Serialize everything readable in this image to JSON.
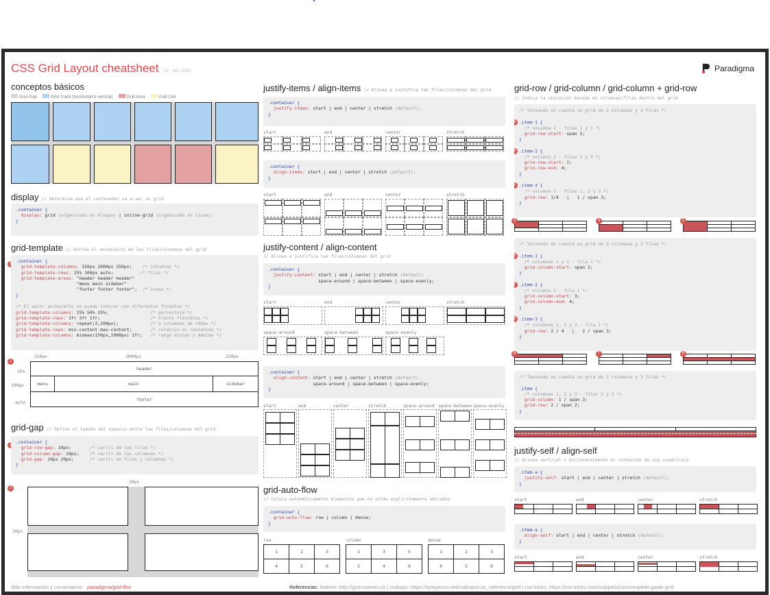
{
  "header": {
    "title": "CSS Grid Layout cheatsheet",
    "version": "V2 - feb. 2020",
    "brand": "Paradigma"
  },
  "colors": {
    "accent": "#e0484e",
    "track": "#aed3f2",
    "area": "#e3a1a2",
    "cell": "#faf3c4",
    "gap": "#d8d8d8"
  },
  "basics": {
    "title": "conceptos básicos",
    "legend": [
      "Grid Gap",
      "Grid Track (horizontal o vertical)",
      "Grid Area",
      "Grid Cell"
    ]
  },
  "display": {
    "title": "display",
    "comment": "// Determina que el contenedor va a ser un grid",
    "code": [
      ".container {",
      "  display:",
      " grid",
      " (organizado en bloque)",
      " | inline-grid",
      " (organizado en línea);",
      "}"
    ]
  },
  "template": {
    "title": "grid-template",
    "comment": "// Define el ancho/alto de las filas/columnas del grid",
    "lines": [
      {
        "t": "s",
        "v": ".container {"
      },
      {
        "t": "p",
        "v": "  grid-template-columns:",
        "r": " 150px 1000px 250px;",
        "c": "    /* columnas */"
      },
      {
        "t": "p",
        "v": "  grid-template-rows:",
        "r": " 25% 100px auto;",
        "c": "          /* filas */"
      },
      {
        "t": "p",
        "v": "  grid-template-areas:",
        "r": " \"header header header\"",
        "c": ""
      },
      {
        "t": "v",
        "v": "                       \"menu main sidebar\"",
        "c": ""
      },
      {
        "t": "v",
        "v": "                       \"footer footer footer\";",
        "c": "  /* áreas */"
      },
      {
        "t": "s",
        "v": "}"
      },
      {
        "t": "v",
        "v": " ",
        "c": ""
      },
      {
        "t": "c",
        "v": "/* El valor ancho/alto se puede indicar con diferentes formatos */"
      },
      {
        "t": "p",
        "v": "grid-template-columns:",
        "r": " 25% 50% 25%;",
        "c": "                /* porcentaje */"
      },
      {
        "t": "p",
        "v": "grid-template-rows:",
        "r": " 1fr 3fr 1fr;",
        "c": "                   /* tracks flexibles */"
      },
      {
        "t": "p",
        "v": "grid-template-columns:",
        "r": " repeat(3,200px);",
        "c": "            /* 3 columnas de 200px */"
      },
      {
        "t": "p",
        "v": "grid-template-rows:",
        "r": " min-content max-content;",
        "c": "       /* relativo al contenido */"
      },
      {
        "t": "p",
        "v": "grid-template-columns:",
        "r": " minmax(150px,1000px) 1fr;",
        "c": "   /* rango mínimo y máximo */"
      }
    ],
    "cols": [
      "150px",
      "1000px",
      "250px"
    ],
    "rows": [
      "25%",
      "100px",
      "auto"
    ],
    "areas": {
      "header": "header",
      "menu": "menu",
      "main": "main",
      "sidebar": "sidebar",
      "footer": "footer"
    }
  },
  "gap": {
    "title": "grid-gap",
    "comment": "// Define el tamaño del espacio entre las filas/columnas del grid",
    "lines": [
      {
        "t": "s",
        "v": ".container {"
      },
      {
        "t": "p",
        "v": "  grid-row-gap:",
        "r": " 10px;",
        "c": "       /* carril de las filas */"
      },
      {
        "t": "p",
        "v": "  grid-column-gap:",
        "r": " 20px;",
        "c": "    /* carril de las columnas */"
      },
      {
        "t": "p",
        "v": "  grid-gap:",
        "r": " 10px 20px;",
        "c": "      /* carril de filas y columnas */"
      },
      {
        "t": "s",
        "v": "}"
      }
    ],
    "colgap": "20px",
    "rowgap": "10px"
  },
  "justify_items": {
    "title": "justify-items / align-items",
    "comment": "// Alinea o justifica las filas/columnas del grid",
    "code1": [
      ".container {",
      "  justify-items:",
      " start | end | center | stretch",
      " (default);",
      "}"
    ],
    "code2": [
      ".container {",
      "  align-items:",
      " start | end | center | stretch",
      " (default);",
      "}"
    ],
    "labels": [
      "start",
      "end",
      "center",
      "stretch"
    ]
  },
  "justify_content": {
    "title": "justify-content / align-content",
    "comment": "// Alinea o justifica las filas/columnas del grid",
    "code1": [
      ".container {",
      "  justify-content:",
      " start | end | center | stretch",
      " (default)",
      "                   space-around | space-between | space-evenly;",
      "}"
    ],
    "code2": [
      ".container {",
      "  align-content:",
      " start | end | center | stretch",
      " (default)",
      "                 space-around | space-between | space-evenly;",
      "}"
    ],
    "labels1": [
      "start",
      "end",
      "center",
      "stretch"
    ],
    "labels2": [
      "space-around",
      "space-between",
      "space-evenly"
    ],
    "labels3": [
      "start",
      "end",
      "center",
      "stretch",
      "space-around",
      "space-between",
      "space-evenly"
    ]
  },
  "auto_flow": {
    "title": "grid-auto-flow",
    "comment": "// Coloca automáticamente elementos que no están explícitamente ubicados",
    "code": [
      ".container {",
      "  grid-auto-flow:",
      " row | column | dense;",
      "}"
    ],
    "labels": [
      "row",
      "column",
      "dense"
    ],
    "row": [
      "1",
      "2",
      "3",
      "4",
      "5",
      "6"
    ],
    "column": [
      "1",
      "3",
      "5",
      "2",
      "4",
      "6"
    ],
    "dense": [
      "1",
      "2",
      "3",
      "4",
      "5",
      "6"
    ]
  },
  "grid_row": {
    "title": "grid-row / grid-column / grid-column + grid-row",
    "comment": "// Indica la ubicación basada en columnas/filas dentro del grid",
    "note": "/* Teniendo en cuenta un grid de 3 columnas y 3 filas */",
    "items1": [
      {
        "n": "3",
        "sel": ".item-1 {",
        "c": "/* columna 1 - filas 1 y 2 */",
        "props": [
          [
            "grid-row-start:",
            " span 2;"
          ]
        ]
      },
      {
        "n": "4",
        "sel": ".item-2 {",
        "c": "/* columna 1 - filas 2 y 3 */",
        "props": [
          [
            "grid-row-start:",
            " 2;"
          ],
          [
            "grid-row-end:",
            " 4;"
          ]
        ]
      },
      {
        "n": "5",
        "sel": ".item-3 {",
        "c": "/* columna 1 - filas 1, 2 y 3 */",
        "props": [
          [
            "grid-row:",
            " 1/4   |   1 / span 3;"
          ]
        ]
      }
    ],
    "items2": [
      {
        "n": "6",
        "sel": ".item-1 {",
        "c": "/* columnas 1 y 2 - fila 1 */",
        "props": [
          [
            "grid-column-start:",
            " span 2;"
          ]
        ]
      },
      {
        "n": "7",
        "sel": ".item-2 {",
        "c": "/* columna 3 - fila 1 */",
        "props": [
          [
            "grid-column-start:",
            " 3;"
          ],
          [
            "grid-column-end:",
            " 4;"
          ]
        ]
      },
      {
        "n": "8",
        "sel": ".item-3 {",
        "c": "/* columnas 1, 2 y 3 - fila 1 */",
        "props": [
          [
            "grid-row:",
            " 2 / 4   |   2 / span 3;"
          ]
        ]
      }
    ],
    "item3": {
      "sel": ".item {",
      "c": "/* columnas 1, 2 y 3 - filas 2 y 3 */",
      "props": [
        [
          "grid-column:",
          " 1 / span 3;"
        ],
        [
          "grid-row:",
          " 2 / span 2;"
        ]
      ]
    }
  },
  "justify_self": {
    "title": "justify-self / align-self",
    "comment": "// Alinea vertical u horizontalmente el contenido de una cuadrícula",
    "code1": [
      ".item-a {",
      "  justify-self:",
      " start | end | center | stretch",
      " (default);",
      "}"
    ],
    "code2": [
      ".item-a {",
      "  align-self:",
      " start | end | center | stretch",
      " (default);",
      "}"
    ],
    "labels": [
      "start",
      "end",
      "center",
      "stretch"
    ]
  },
  "footer": {
    "more": "Más información y comentarios:",
    "link": "paradigma/grid-flex",
    "refs_label": "Referencias:",
    "refs": "Malven: http://grid.malven.co  |  codrops: https://tympanus.net/codrops/css_reference/grid  |  css-tricks: https://css-tricks.com/snippets/css/complete-guide-grid"
  }
}
